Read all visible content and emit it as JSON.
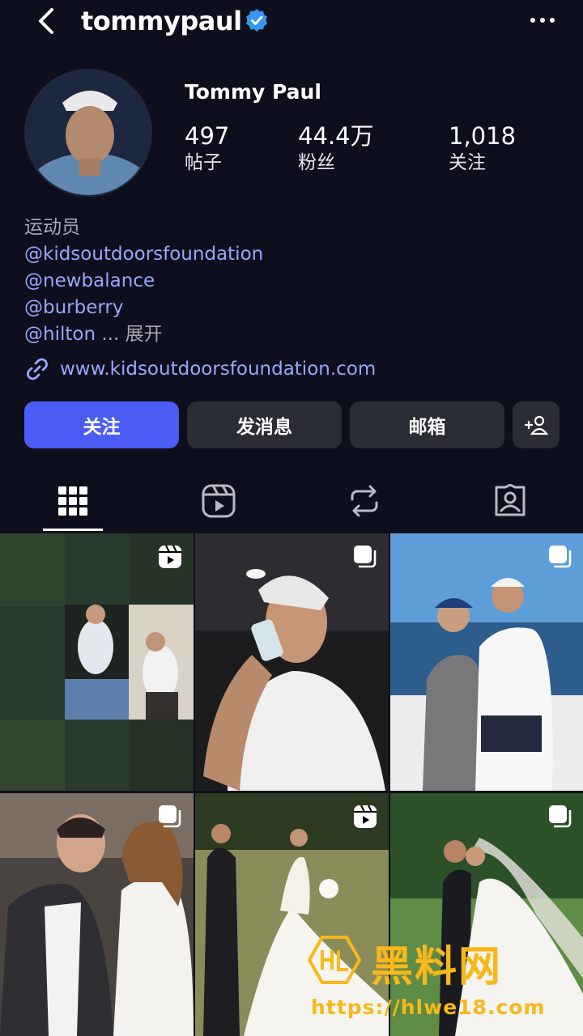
{
  "header": {
    "handle": "tommypaul",
    "icons": [
      "back-arrow-icon",
      "verified-badge-icon",
      "more-options-icon"
    ]
  },
  "profile": {
    "display_name": "Tommy Paul",
    "stats": [
      {
        "value": "497",
        "label": "帖子"
      },
      {
        "value": "44.4万",
        "label": "粉丝"
      },
      {
        "value": "1,018",
        "label": "关注"
      }
    ],
    "bio": {
      "category": "运动员",
      "mentions": [
        "@kidsoutdoorsfoundation",
        "@newbalance",
        "@burberry"
      ],
      "last_mention": "@hilton",
      "ellipsis": " ... ",
      "expand": "展开"
    },
    "website": "www.kidsoutdoorsfoundation.com"
  },
  "actions": {
    "follow": "关注",
    "message": "发消息",
    "mail": "邮箱"
  },
  "tabs": [
    "grid-icon",
    "reels-icon",
    "reposts-icon",
    "tagged-icon"
  ],
  "grid": [
    {
      "badge": "reel"
    },
    {
      "badge": "carousel"
    },
    {
      "badge": "carousel"
    },
    {
      "badge": "carousel"
    },
    {
      "badge": "reel"
    },
    {
      "badge": "carousel"
    }
  ],
  "watermark": {
    "title": "黑料网",
    "url": "https://hlwe18.com"
  },
  "colors": {
    "background": "#0e0f1c",
    "accent": "#4b5cf5",
    "link": "#9aa6ff"
  }
}
